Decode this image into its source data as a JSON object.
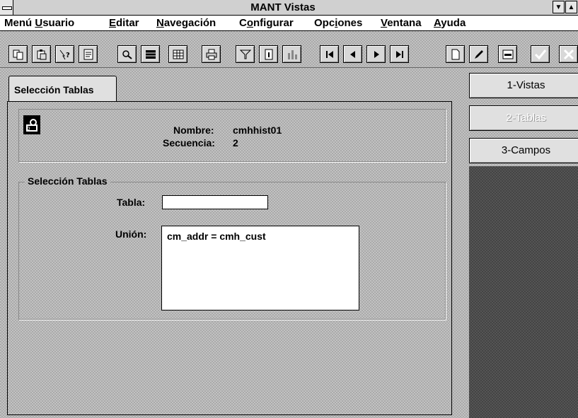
{
  "window": {
    "title": "MANT Vistas"
  },
  "menu": [
    {
      "pre": "Menú ",
      "u": "U",
      "post": "suario"
    },
    {
      "pre": "",
      "u": "E",
      "post": "ditar"
    },
    {
      "pre": "",
      "u": "N",
      "post": "avegación"
    },
    {
      "pre": "C",
      "u": "o",
      "post": "nfigurar"
    },
    {
      "pre": "Opc",
      "u": "i",
      "post": "ones"
    },
    {
      "pre": "",
      "u": "V",
      "post": "entana"
    },
    {
      "pre": "",
      "u": "A",
      "post": "yuda"
    }
  ],
  "toolbar": {
    "icons": [
      "copy-icon",
      "paste-icon",
      "help-icon",
      "notes-icon",
      "find-icon",
      "grid-icon",
      "table-icon",
      "print-icon",
      "filter-icon",
      "info-icon",
      "chart-icon",
      "first-record-icon",
      "prev-record-icon",
      "next-record-icon",
      "last-record-icon",
      "new-record-icon",
      "edit-icon",
      "delete-icon",
      "accept-icon",
      "cancel-icon"
    ]
  },
  "tab": {
    "label": "Selección Tablas"
  },
  "info": {
    "nombre_label": "Nombre:",
    "nombre_value": "cmhhist01",
    "secuencia_label": "Secuencia:",
    "secuencia_value": "2"
  },
  "selection": {
    "title": "Selección Tablas",
    "tabla_label": "Tabla:",
    "tabla_value": "",
    "union_label": "Unión:",
    "union_value": "cm_addr = cmh_cust"
  },
  "nav": [
    {
      "label": "1-Vistas",
      "enabled": true
    },
    {
      "label": "2-Tablas",
      "enabled": false
    },
    {
      "label": "3-Campos",
      "enabled": true
    }
  ]
}
